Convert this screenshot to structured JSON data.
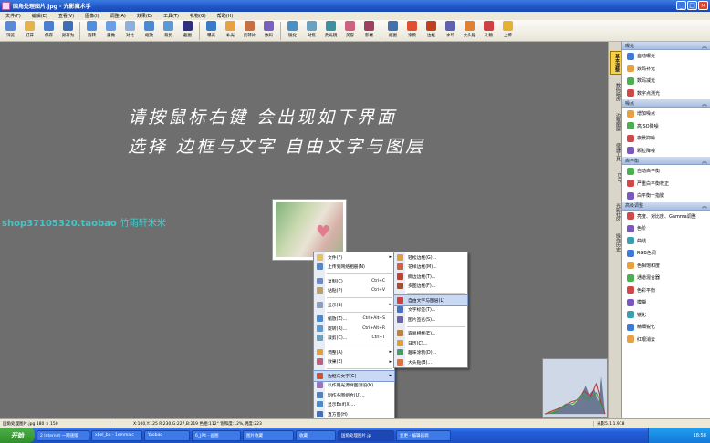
{
  "window": {
    "title": "国角处理图片.jpg - 光影魔术手"
  },
  "menubar": [
    "文件(F)",
    "编辑(E)",
    "查看(V)",
    "图像(I)",
    "调整(A)",
    "效果(E)",
    "工具(T)",
    "礼物(G)",
    "帮助(H)"
  ],
  "toolbar": [
    {
      "label": "浏览",
      "color": "#5a8ad6"
    },
    {
      "label": "打开",
      "color": "#e7b24a"
    },
    {
      "label": "保存",
      "color": "#4a7fd0"
    },
    {
      "label": "另存为",
      "color": "#3d6fb8"
    },
    {
      "label": "旋转",
      "color": "#4f8fe0"
    },
    {
      "label": "重做",
      "color": "#6a9fe8"
    },
    {
      "label": "对比",
      "color": "#8ab0e0"
    },
    {
      "label": "缩放",
      "color": "#4a8ad0"
    },
    {
      "label": "裁剪",
      "color": "#5a9ad6"
    },
    {
      "label": "截图",
      "color": "#2f2f80"
    },
    {
      "label": "曝光",
      "color": "#3a7ac8"
    },
    {
      "label": "补光",
      "color": "#e8a040"
    },
    {
      "label": "反转片",
      "color": "#c87040"
    },
    {
      "label": "数码",
      "color": "#7a60c0"
    },
    {
      "label": "锐化",
      "color": "#4a90c8"
    },
    {
      "label": "对焦",
      "color": "#6aa0c0"
    },
    {
      "label": "柔光镜",
      "color": "#3c90a0"
    },
    {
      "label": "美容",
      "color": "#d06080"
    },
    {
      "label": "影楼",
      "color": "#a04060"
    },
    {
      "label": "抠图",
      "color": "#4070b0"
    },
    {
      "label": "涂鸦",
      "color": "#e05030"
    },
    {
      "label": "边框",
      "color": "#c04020"
    },
    {
      "label": "水印",
      "color": "#6060b0"
    },
    {
      "label": "大头贴",
      "color": "#e08030"
    },
    {
      "label": "礼物",
      "color": "#d04040"
    },
    {
      "label": "上传",
      "color": "#e8b030"
    }
  ],
  "canvas": {
    "line1": "请按鼠标右键 会出现如下界面",
    "line2": "选择 边框与文字 自由文字与图层",
    "shop_id": "shop37105320.taobao",
    "shop_name": "竹雨轩米米"
  },
  "tabstrip": [
    "基本调整",
    "数码暗房",
    "边框图层",
    "便捷工具",
    "EXIF",
    "光影社区",
    "操作历史"
  ],
  "panel": {
    "sections": [
      {
        "title": "曝光",
        "items": [
          "自动曝光",
          "数码补光",
          "数码减光",
          "数字点测光"
        ]
      },
      {
        "title": "噪点",
        "items": [
          "增加噪点",
          "高ISO降噪",
          "夜景抑噪",
          "颗粒降噪"
        ]
      },
      {
        "title": "白平衡",
        "items": [
          "自动白平衡",
          "严重白平衡校正",
          "白平衡一指键"
        ]
      },
      {
        "title": "高级调整",
        "items": [
          "亮度、对比度、Gamma调整",
          "色阶",
          "曲线",
          "RGB色调",
          "色相饱和度",
          "通道混合器",
          "色彩平衡",
          "模糊",
          "锐化",
          "精细锐化",
          "红眼消去"
        ]
      }
    ],
    "colors": [
      "#3d7cd6",
      "#e8a040",
      "#4caf50",
      "#d04848",
      "#7a58c0",
      "#3aa0b0"
    ]
  },
  "context_menu": {
    "items": [
      {
        "label": "文件(F)",
        "arrow": true,
        "color": "#e8c060"
      },
      {
        "label": "上传到网络相册(N)",
        "color": "#4a8ad0"
      },
      {
        "sep": true
      },
      {
        "label": "复制(C)",
        "shortcut": "Ctrl+C",
        "color": "#6a8ad0"
      },
      {
        "label": "粘贴(P)",
        "shortcut": "Ctrl+V",
        "color": "#c0a060"
      },
      {
        "sep": true
      },
      {
        "label": "显示(S)",
        "arrow": true,
        "color": "#8aa0c0"
      },
      {
        "sep": true
      },
      {
        "label": "缩放(Z)...",
        "shortcut": "Ctrl+Alt+S",
        "color": "#4a8ad0"
      },
      {
        "label": "旋转(R)...",
        "shortcut": "Ctrl+Alt+R",
        "color": "#5a9ad6"
      },
      {
        "label": "裁剪(C)...",
        "shortcut": "Ctrl+T",
        "color": "#6aa0c0"
      },
      {
        "sep": true
      },
      {
        "label": "调整(A)",
        "arrow": true,
        "color": "#e0a040"
      },
      {
        "label": "效果(E)",
        "arrow": true,
        "color": "#c06080"
      },
      {
        "sep": true
      },
      {
        "label": "边框与文字(G)",
        "arrow": true,
        "highlight": true,
        "color": "#d05030"
      },
      {
        "label": "以作用光源样图测设(K)",
        "color": "#a070c0"
      },
      {
        "label": "制作多图组合(U)...",
        "color": "#5080c0"
      },
      {
        "label": "显示Exif(X)...",
        "color": "#4a8ad0"
      },
      {
        "label": "直方图(H)",
        "color": "#3d70c0"
      }
    ]
  },
  "submenu": {
    "items": [
      {
        "label": "轻松边框(G)...",
        "color": "#e0a040"
      },
      {
        "label": "花样边框(M)...",
        "color": "#d06040"
      },
      {
        "label": "撕边边框(T)...",
        "color": "#c04030"
      },
      {
        "label": "多图边框(F)...",
        "color": "#a05030"
      },
      {
        "sep": true
      },
      {
        "label": "自由文字与图层(L)",
        "highlight": true,
        "color": "#d04040"
      },
      {
        "label": "文字标签(T)...",
        "color": "#4a70c0"
      },
      {
        "label": "图片签名(S)...",
        "color": "#7060b0"
      },
      {
        "sep": true
      },
      {
        "label": "容易相框(E)...",
        "color": "#c08040"
      },
      {
        "label": "日历(C)...",
        "color": "#e0a030"
      },
      {
        "label": "趣味涂鸦(D)...",
        "color": "#40a060"
      },
      {
        "label": "大头贴(B)...",
        "color": "#e07040"
      }
    ]
  },
  "status": {
    "left": "国角处理图片.jpg  180 × 150",
    "middle": "X:100,Y:125 R:230,G:227,B:219 色相:112° 饱和度:12%,明度:223",
    "right": "光影5.1.1.918"
  },
  "taskbar": {
    "start": "开始",
    "tasks": [
      "2 Internet 一网速版",
      "xbel_bu - 1emmaic",
      "Yaobao",
      "6_JP4 - 画图",
      "图片收藏",
      "收藏",
      "国角处理图片.jp",
      "变更 - 编辑器调"
    ],
    "clock": "18:58"
  }
}
